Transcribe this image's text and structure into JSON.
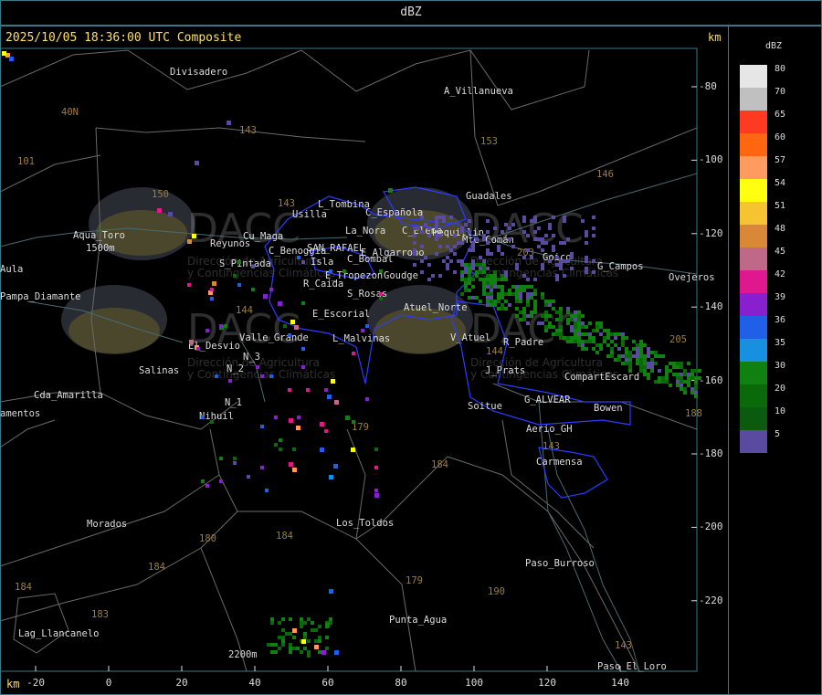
{
  "header": {
    "title": "dBZ"
  },
  "map": {
    "timestamp": "2025/10/05 18:36:00 UTC Composite",
    "unit_top": "km",
    "unit_bottom": "km",
    "y_ticks": [
      "-80",
      "-100",
      "-120",
      "-140",
      "-160",
      "-180",
      "-200",
      "-220"
    ],
    "x_ticks": [
      "-20",
      "0",
      "20",
      "40",
      "60",
      "80",
      "100",
      "120",
      "140"
    ],
    "places": [
      "Divisadero",
      "A_Villanueva",
      "Usilla",
      "L_Tombina",
      "C_Española",
      "La_Nora",
      "C_Elena",
      "Pequillin",
      "Guadales",
      "Aqua_Toro",
      "Reyunos",
      "S_Pintada",
      "Cu_Maga",
      "C_Benoggia",
      "SAN_RAFAEL",
      "E_Algarrobo",
      "C_Bombal",
      "Isla",
      "E_Tropezon",
      "Goudge",
      "R_Caida",
      "S_Rosas",
      "Goico",
      "G_Campos",
      "Ovejeros",
      "Pampa_Diamante",
      "Aula",
      "E_Escorial",
      "Atuel_Norte",
      "Valle_Grande",
      "L_Malvinas",
      "V_Atuel",
      "R_Padre",
      "El_Desvio",
      "N_3",
      "N_2",
      "N_1",
      "Salinas",
      "J_Prats",
      "CompartEscard",
      "Cda_Amarilla",
      "G_ALVEAR",
      "Soitue",
      "Bowen",
      "Nihuil",
      "amentos",
      "Aerio_GH",
      "Carmensa",
      "Morados",
      "Los_Toldos",
      "Paso_Burroso",
      "Punta_Agua",
      "Lag_Llancanelo",
      "Paso_El_Loro",
      "Mte_Comán",
      "1500m",
      "2200m"
    ],
    "route_numbers": [
      "143",
      "153",
      "146",
      "101",
      "40N",
      "150",
      "143",
      "144",
      "144",
      "203",
      "143",
      "179",
      "184",
      "184",
      "180",
      "184",
      "179",
      "190",
      "183",
      "184",
      "143",
      "205",
      "188"
    ],
    "watermark": [
      "DACC",
      "Dirección de Agricultura",
      "y Contingencias Climáticas",
      "DACC",
      "Dirección de Agricultura",
      "y Contingencias Climáticas",
      "DACC",
      "Dirección de Agricultura",
      "y Contingencias Climáticas",
      "DACC",
      "Dirección de Agricultura",
      "y Contingencias Climáticas"
    ],
    "watermark_url": "http://www.contingencias.mendoza.gov.ar"
  },
  "legend": {
    "title": "dBZ",
    "levels": [
      {
        "value": "80",
        "color": "#e6e6e6"
      },
      {
        "value": "70",
        "color": "#c0c0c0"
      },
      {
        "value": "65",
        "color": "#ff3a22"
      },
      {
        "value": "60",
        "color": "#ff6610"
      },
      {
        "value": "57",
        "color": "#ff9a60"
      },
      {
        "value": "54",
        "color": "#ffff10"
      },
      {
        "value": "51",
        "color": "#f6c430"
      },
      {
        "value": "48",
        "color": "#d98838"
      },
      {
        "value": "45",
        "color": "#c06888"
      },
      {
        "value": "42",
        "color": "#e01890"
      },
      {
        "value": "39",
        "color": "#8820d0"
      },
      {
        "value": "36",
        "color": "#2060e8"
      },
      {
        "value": "35",
        "color": "#1890e0"
      },
      {
        "value": "30",
        "color": "#108010"
      },
      {
        "value": "20",
        "color": "#0a6a0a"
      },
      {
        "value": "10",
        "color": "#0a5a10"
      },
      {
        "value": "5",
        "color": "#5a4aa0"
      }
    ]
  }
}
